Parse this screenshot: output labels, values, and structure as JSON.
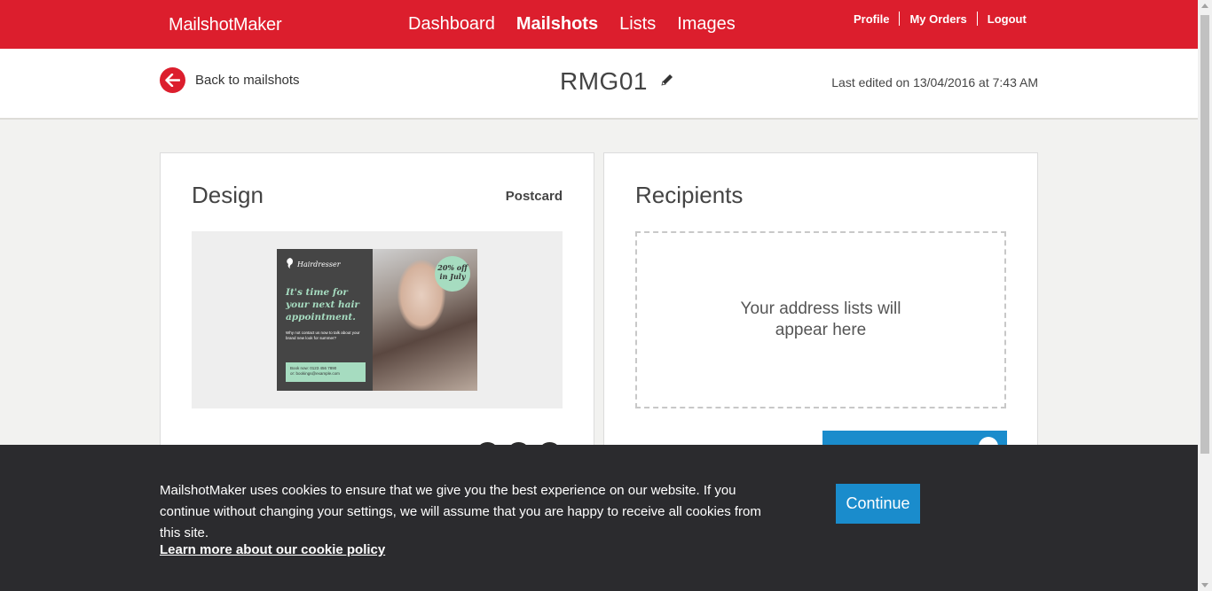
{
  "header": {
    "brand": "MailshotMaker",
    "nav": [
      {
        "label": "Dashboard"
      },
      {
        "label": "Mailshots",
        "active": true
      },
      {
        "label": "Lists"
      },
      {
        "label": "Images"
      }
    ],
    "user_nav": {
      "profile": "Profile",
      "orders": "My Orders",
      "logout": "Logout"
    },
    "accent_color": "#dc1e2d"
  },
  "subheader": {
    "back_label": "Back to mailshots",
    "title": "RMG01",
    "last_edited": "Last edited on 13/04/2016 at 7:43 AM"
  },
  "design": {
    "heading": "Design",
    "type": "Postcard",
    "postcard": {
      "brand": "Hairdresser",
      "headline": "It's time for your next hair appointment.",
      "body": "Why not contact us now to talk about your brand new look for summer?",
      "book_line1": "Book now: 0123 456 7890",
      "book_line2": "or: bookings@example.com",
      "offer": "20% off in July"
    }
  },
  "recipients": {
    "heading": "Recipients",
    "placeholder": "Your address lists will appear here"
  },
  "cookie": {
    "message": "MailshotMaker uses cookies to ensure that we give you the best experience on our website. If you continue without changing your settings, we will assume that you are happy to receive all cookies from this site.",
    "continue_label": "Continue",
    "policy_link": "Learn more about our cookie policy",
    "button_color": "#1a8ccc"
  }
}
